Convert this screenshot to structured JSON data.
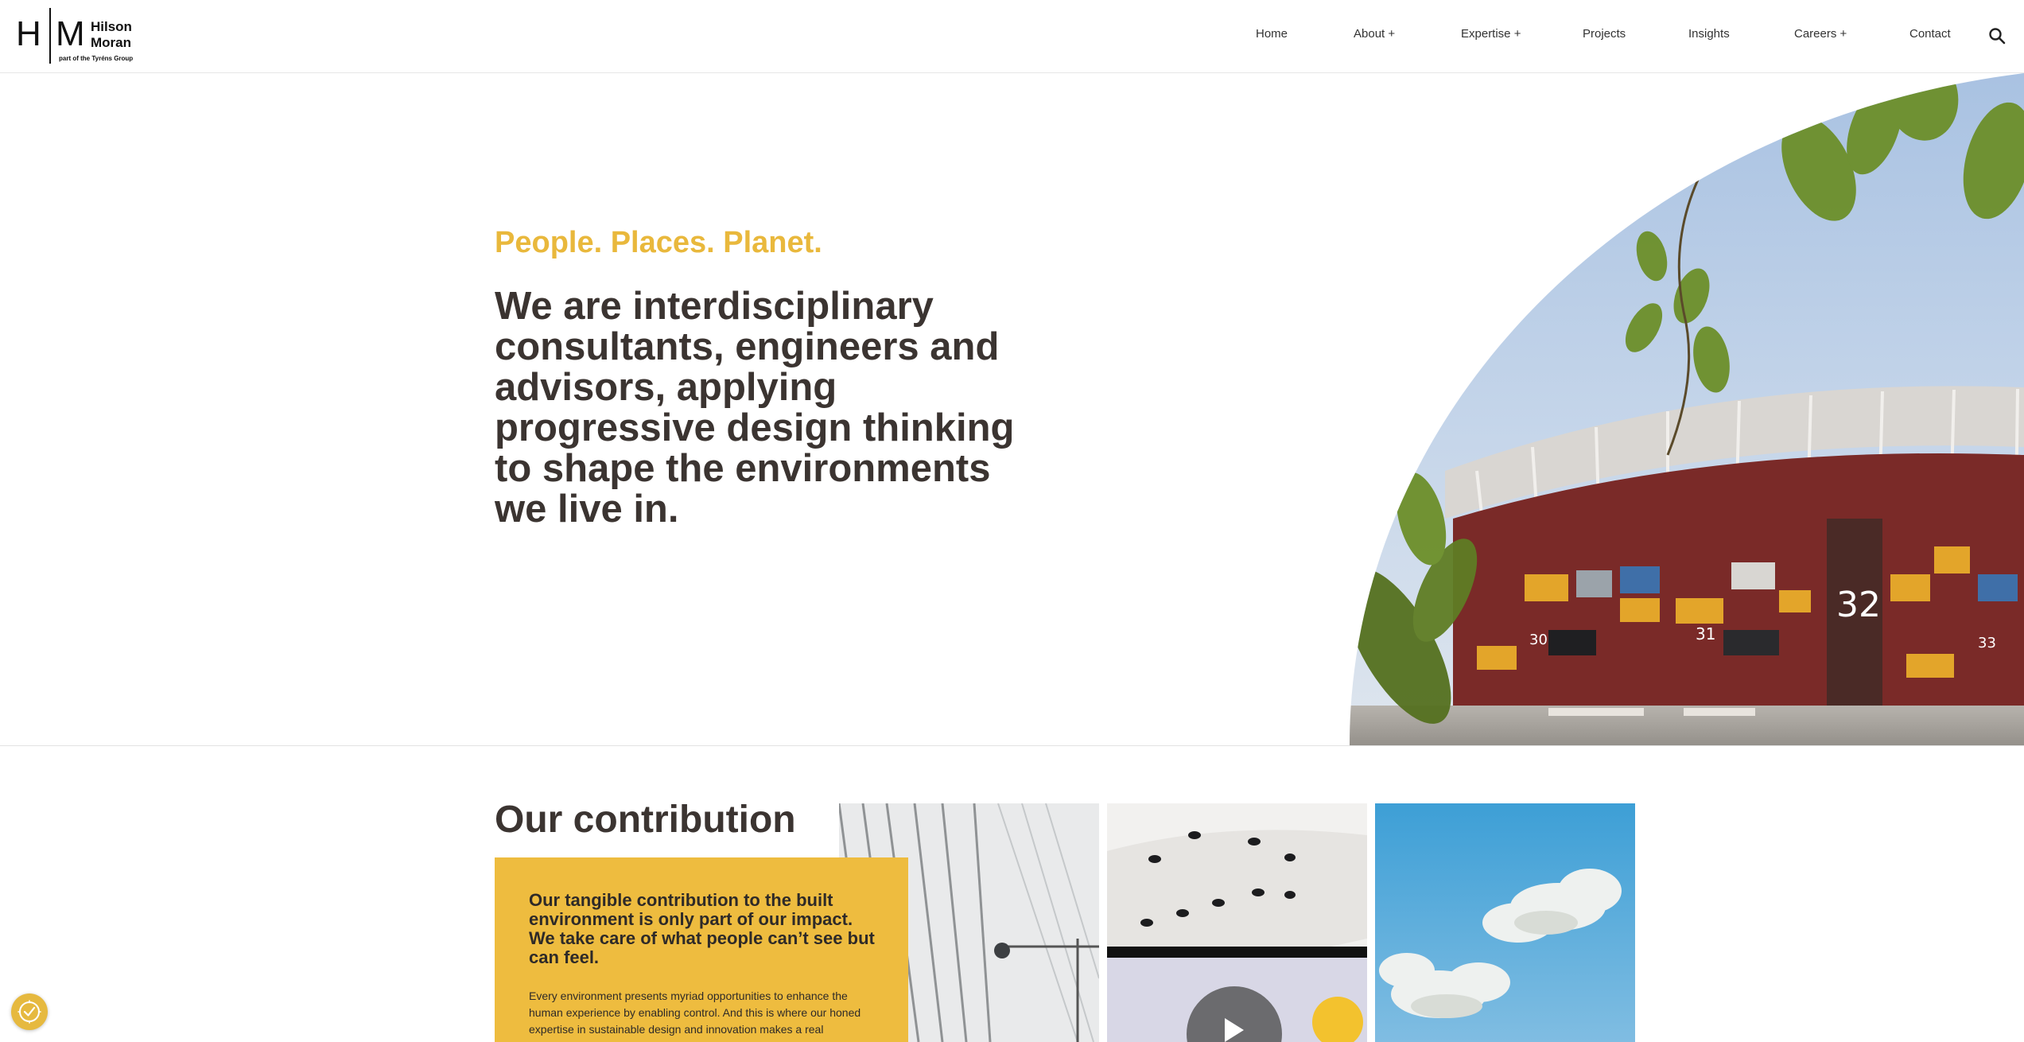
{
  "logo": {
    "letters_left": "H",
    "letters_right": "M",
    "name_line1": "Hilson",
    "name_line2": "Moran",
    "subline": "part of the Tyréns Group"
  },
  "nav": {
    "items": [
      {
        "label": "Home"
      },
      {
        "label": "About +"
      },
      {
        "label": "Expertise +"
      },
      {
        "label": "Projects"
      },
      {
        "label": "Insights"
      },
      {
        "label": "Careers +"
      },
      {
        "label": "Contact"
      }
    ],
    "search_icon": "search-icon"
  },
  "hero": {
    "tagline": "People. Places. Planet.",
    "headline": "We are interdisciplinary consultants, engineers and advisors, applying progressive design thinking to shape the environments we live in.",
    "image_labels": [
      "30",
      "31",
      "32",
      "33"
    ]
  },
  "contribution": {
    "title": "Our contribution",
    "heading": "Our tangible contribution to the built environment is only part of our impact. We take care of what people can’t see but can feel.",
    "body": "Every environment presents myriad opportunities to enhance the human experience by enabling control. And this is where our honed expertise in sustainable design and innovation makes a real difference."
  },
  "colors": {
    "accent": "#e9b83c",
    "heading": "#3b3431",
    "box": "#eebc3f"
  },
  "cookie": {
    "icon": "cookie-settings-icon"
  }
}
